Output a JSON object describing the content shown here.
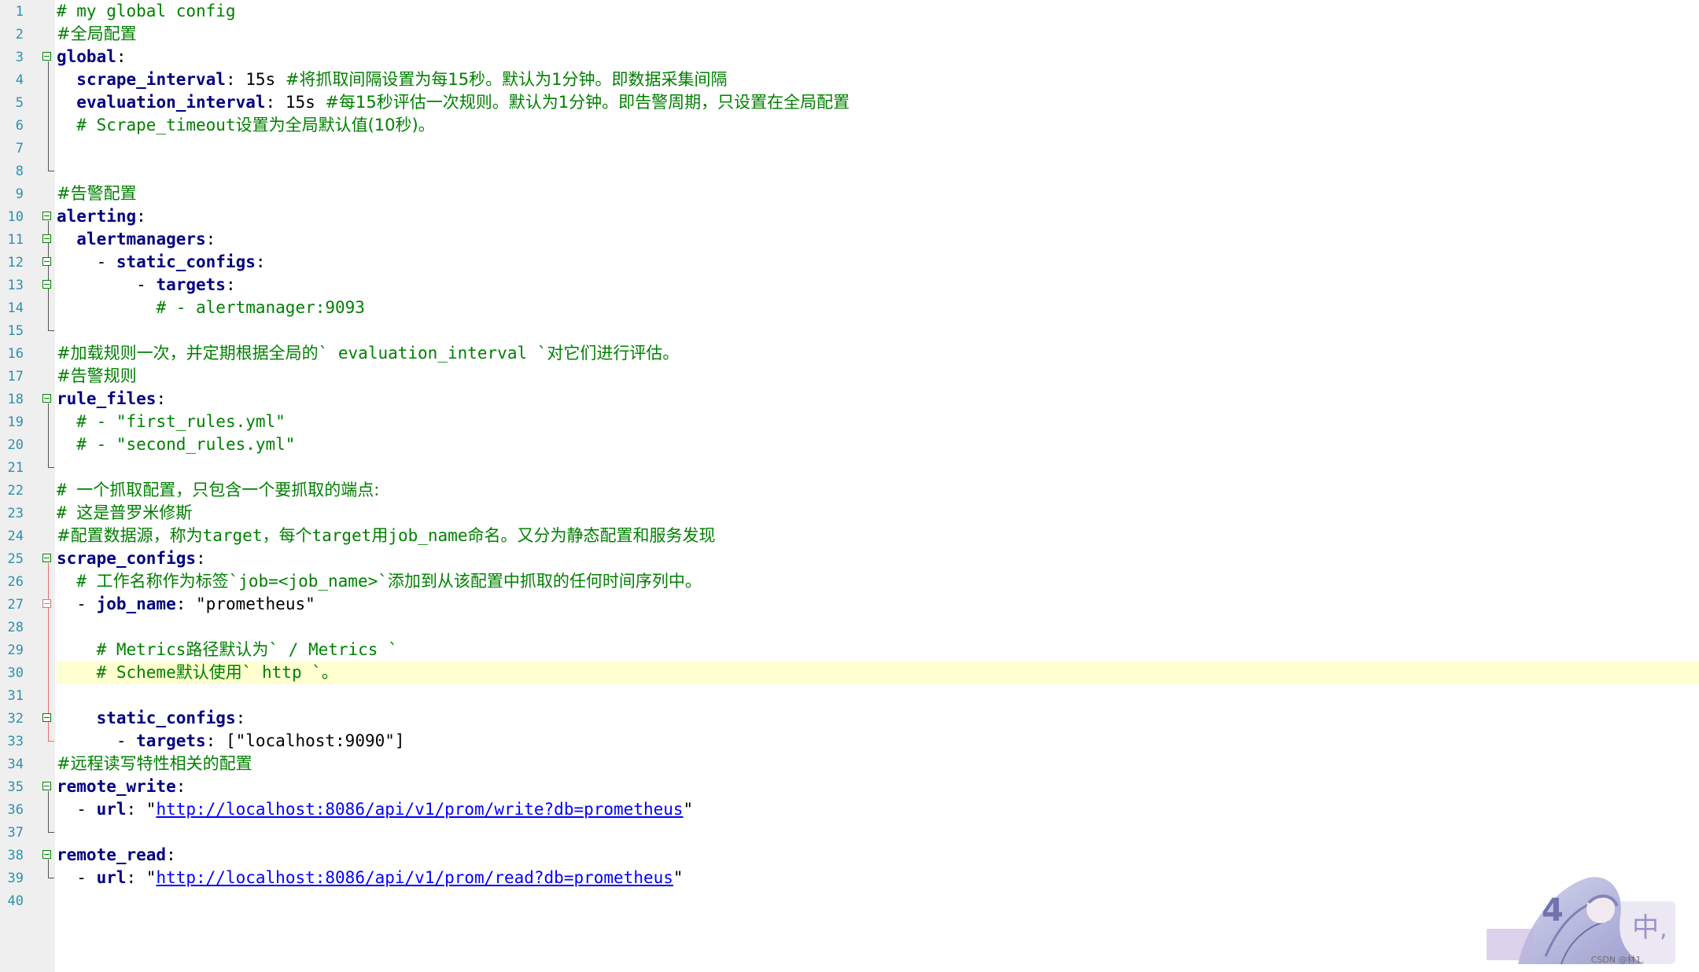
{
  "editor": {
    "current_line": 30,
    "lines": [
      {
        "n": "1",
        "segs": [
          [
            "cm",
            "# my global config"
          ]
        ]
      },
      {
        "n": "2",
        "segs": [
          [
            "c",
            "#全局配置"
          ]
        ]
      },
      {
        "n": "3",
        "segs": [
          [
            "k",
            "global"
          ],
          [
            "p",
            ":"
          ]
        ]
      },
      {
        "n": "4",
        "segs": [
          [
            "p",
            "  "
          ],
          [
            "k",
            "scrape_interval"
          ],
          [
            "p",
            ": "
          ],
          [
            "v",
            "15s "
          ],
          [
            "c",
            "#将抓取间隔设置为每15秒。默认为1分钟。即数据采集间隔"
          ]
        ]
      },
      {
        "n": "5",
        "segs": [
          [
            "p",
            "  "
          ],
          [
            "k",
            "evaluation_interval"
          ],
          [
            "p",
            ": "
          ],
          [
            "v",
            "15s "
          ],
          [
            "c",
            "#每15秒评估一次规则。默认为1分钟。即告警周期，只设置在全局配置"
          ]
        ]
      },
      {
        "n": "6",
        "segs": [
          [
            "p",
            "  "
          ],
          [
            "cm",
            "# Scrape_timeout"
          ],
          [
            "c",
            "设置为全局默认值(10秒)。"
          ]
        ]
      },
      {
        "n": "7",
        "segs": []
      },
      {
        "n": "8",
        "segs": []
      },
      {
        "n": "9",
        "segs": [
          [
            "c",
            "#告警配置"
          ]
        ]
      },
      {
        "n": "10",
        "segs": [
          [
            "k",
            "alerting"
          ],
          [
            "p",
            ":"
          ]
        ]
      },
      {
        "n": "11",
        "segs": [
          [
            "p",
            "  "
          ],
          [
            "k",
            "alertmanagers"
          ],
          [
            "p",
            ":"
          ]
        ]
      },
      {
        "n": "12",
        "segs": [
          [
            "p",
            "    - "
          ],
          [
            "k",
            "static_configs"
          ],
          [
            "p",
            ":"
          ]
        ]
      },
      {
        "n": "13",
        "segs": [
          [
            "p",
            "        - "
          ],
          [
            "k",
            "targets"
          ],
          [
            "p",
            ":"
          ]
        ]
      },
      {
        "n": "14",
        "segs": [
          [
            "p",
            "          "
          ],
          [
            "cm",
            "# - alertmanager:9093"
          ]
        ]
      },
      {
        "n": "15",
        "segs": []
      },
      {
        "n": "16",
        "segs": [
          [
            "c",
            "#加载规则一次，并定期根据全局的"
          ],
          [
            "cm",
            "` evaluation_interval `"
          ],
          [
            "c",
            "对它们进行评估。"
          ]
        ]
      },
      {
        "n": "17",
        "segs": [
          [
            "c",
            "#告警规则"
          ]
        ]
      },
      {
        "n": "18",
        "segs": [
          [
            "k",
            "rule_files"
          ],
          [
            "p",
            ":"
          ]
        ]
      },
      {
        "n": "19",
        "segs": [
          [
            "p",
            "  "
          ],
          [
            "cm",
            "# - \"first_rules.yml\""
          ]
        ]
      },
      {
        "n": "20",
        "segs": [
          [
            "p",
            "  "
          ],
          [
            "cm",
            "# - \"second_rules.yml\""
          ]
        ]
      },
      {
        "n": "21",
        "segs": []
      },
      {
        "n": "22",
        "segs": [
          [
            "cm",
            "# "
          ],
          [
            "c",
            "一个抓取配置，只包含一个要抓取的端点:"
          ]
        ]
      },
      {
        "n": "23",
        "segs": [
          [
            "cm",
            "# "
          ],
          [
            "c",
            "这是普罗米修斯"
          ]
        ]
      },
      {
        "n": "24",
        "segs": [
          [
            "c",
            "#配置数据源，称为"
          ],
          [
            "cm",
            "target"
          ],
          [
            "c",
            "，每个"
          ],
          [
            "cm",
            "target"
          ],
          [
            "c",
            "用"
          ],
          [
            "cm",
            "job_name"
          ],
          [
            "c",
            "命名。又分为静态配置和服务发现"
          ]
        ]
      },
      {
        "n": "25",
        "segs": [
          [
            "k",
            "scrape_configs"
          ],
          [
            "p",
            ":"
          ]
        ]
      },
      {
        "n": "26",
        "segs": [
          [
            "p",
            "  "
          ],
          [
            "cm",
            "# "
          ],
          [
            "c",
            "工作名称作为标签"
          ],
          [
            "cm",
            "`job=<job_name>`"
          ],
          [
            "c",
            "添加到从该配置中抓取的任何时间序列中。"
          ]
        ]
      },
      {
        "n": "27",
        "segs": [
          [
            "p",
            "  - "
          ],
          [
            "k",
            "job_name"
          ],
          [
            "p",
            ": "
          ],
          [
            "s",
            "\"prometheus\""
          ]
        ]
      },
      {
        "n": "28",
        "segs": []
      },
      {
        "n": "29",
        "segs": [
          [
            "p",
            "    "
          ],
          [
            "cm",
            "# Metrics"
          ],
          [
            "c",
            "路径默认为"
          ],
          [
            "cm",
            "` / Metrics `"
          ]
        ]
      },
      {
        "n": "30",
        "segs": [
          [
            "p",
            "    "
          ],
          [
            "cm",
            "# Scheme"
          ],
          [
            "c",
            "默认使用"
          ],
          [
            "cm",
            "` http `"
          ],
          [
            "c",
            "。"
          ]
        ]
      },
      {
        "n": "31",
        "segs": []
      },
      {
        "n": "32",
        "segs": [
          [
            "p",
            "    "
          ],
          [
            "k",
            "static_configs"
          ],
          [
            "p",
            ":"
          ]
        ]
      },
      {
        "n": "33",
        "segs": [
          [
            "p",
            "      - "
          ],
          [
            "k",
            "targets"
          ],
          [
            "p",
            ": "
          ],
          [
            "s",
            "[\"localhost:9090\"]"
          ]
        ]
      },
      {
        "n": "34",
        "segs": [
          [
            "c",
            "#远程读写特性相关的配置"
          ]
        ]
      },
      {
        "n": "35",
        "segs": [
          [
            "k",
            "remote_write"
          ],
          [
            "p",
            ":"
          ]
        ]
      },
      {
        "n": "36",
        "segs": [
          [
            "p",
            "  - "
          ],
          [
            "k",
            "url"
          ],
          [
            "p",
            ": \""
          ],
          [
            "u",
            "http://localhost:8086/api/v1/prom/write?db=prometheus"
          ],
          [
            "p",
            "\""
          ]
        ]
      },
      {
        "n": "37",
        "segs": []
      },
      {
        "n": "38",
        "segs": [
          [
            "k",
            "remote_read"
          ],
          [
            "p",
            ":"
          ]
        ]
      },
      {
        "n": "39",
        "segs": [
          [
            "p",
            "  - "
          ],
          [
            "k",
            "url"
          ],
          [
            "p",
            ": \""
          ],
          [
            "u",
            "http://localhost:8086/api/v1/prom/read?db=prometheus"
          ],
          [
            "p",
            "\""
          ]
        ]
      },
      {
        "n": "40",
        "segs": []
      }
    ]
  },
  "watermark": {
    "text": "CSDN @林1."
  }
}
